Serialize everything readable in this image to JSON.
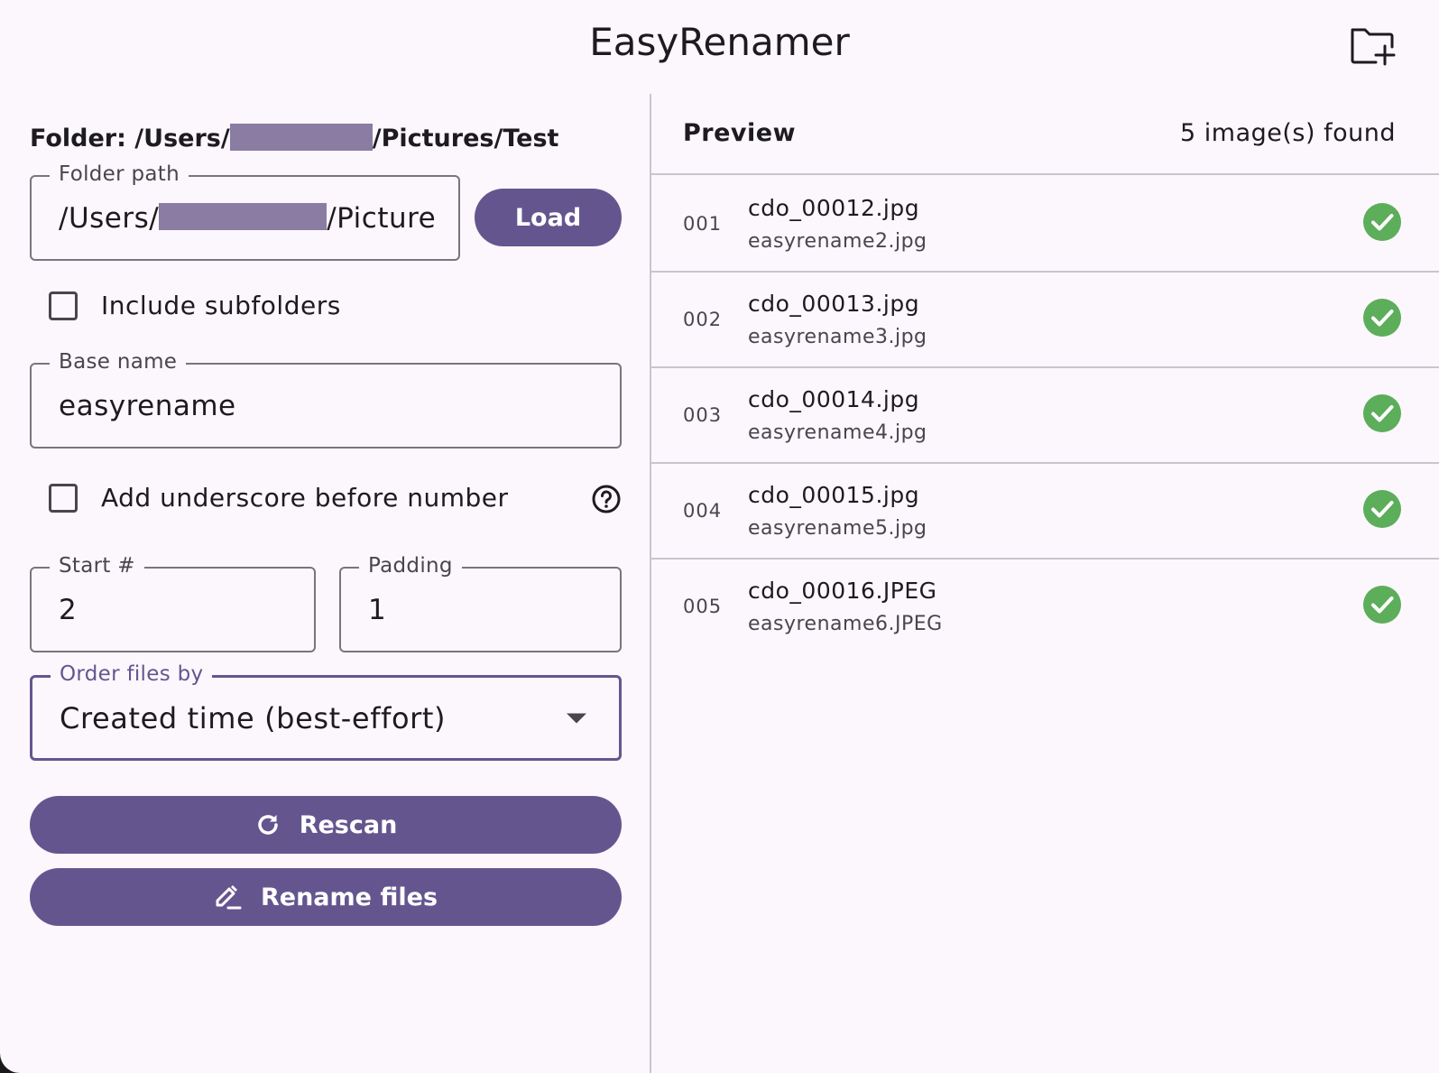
{
  "app": {
    "title": "EasyRenamer",
    "new_folder_icon": "folder-plus-icon"
  },
  "left": {
    "folder_heading_prefix": "Folder: /Users/",
    "folder_heading_suffix": "/Pictures/Test",
    "folder_path": {
      "label": "Folder path",
      "value_prefix": "/Users/",
      "value_suffix": "/Picture"
    },
    "load_label": "Load",
    "include_subfolders": {
      "label": "Include subfolders",
      "checked": false
    },
    "base_name": {
      "label": "Base name",
      "value": "easyrename"
    },
    "underscore": {
      "label": "Add underscore before number",
      "checked": false,
      "help_icon": "help-circle-icon"
    },
    "start": {
      "label": "Start #",
      "value": "2"
    },
    "padding": {
      "label": "Padding",
      "value": "1"
    },
    "order": {
      "label": "Order files by",
      "value": "Created time (best-effort)"
    },
    "rescan_label": "Rescan",
    "rename_label": "Rename files"
  },
  "preview": {
    "title": "Preview",
    "count": "5 image(s) found",
    "rows": [
      {
        "index": "001",
        "old": "cdo_00012.jpg",
        "new": "easyrename2.jpg",
        "status": "ok"
      },
      {
        "index": "002",
        "old": "cdo_00013.jpg",
        "new": "easyrename3.jpg",
        "status": "ok"
      },
      {
        "index": "003",
        "old": "cdo_00014.jpg",
        "new": "easyrename4.jpg",
        "status": "ok"
      },
      {
        "index": "004",
        "old": "cdo_00015.jpg",
        "new": "easyrename5.jpg",
        "status": "ok"
      },
      {
        "index": "005",
        "old": "cdo_00016.JPEG",
        "new": "easyrename6.JPEG",
        "status": "ok"
      }
    ]
  },
  "colors": {
    "primary": "#65558f",
    "background": "#fcf7fc",
    "success": "#5cae5a",
    "outline": "#79747e",
    "redaction": "#8a7ca2"
  }
}
